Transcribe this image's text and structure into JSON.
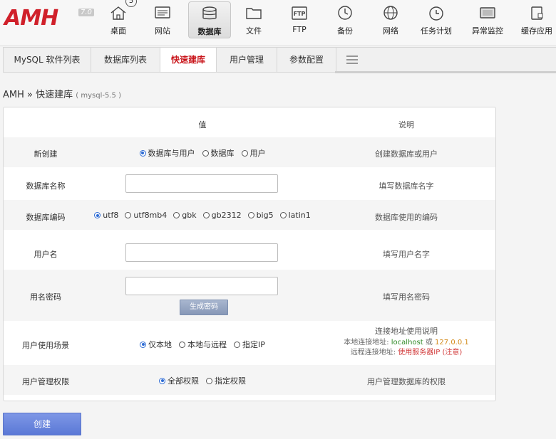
{
  "logo": {
    "text": "AMH",
    "version": "7.0"
  },
  "nav": {
    "badge": "5",
    "items": [
      {
        "label": "桌面",
        "icon": "home-icon"
      },
      {
        "label": "网站",
        "icon": "website-icon"
      },
      {
        "label": "数据库",
        "icon": "database-icon"
      },
      {
        "label": "文件",
        "icon": "folder-icon"
      },
      {
        "label": "FTP",
        "icon": "ftp-icon"
      },
      {
        "label": "备份",
        "icon": "clock-icon"
      },
      {
        "label": "网络",
        "icon": "globe-icon"
      },
      {
        "label": "任务计划",
        "icon": "timer-icon"
      },
      {
        "label": "异常监控",
        "icon": "monitor-icon"
      },
      {
        "label": "缓存应用",
        "icon": "cache-icon"
      }
    ],
    "active": "数据库"
  },
  "subtabs": [
    {
      "label": "MySQL 软件列表"
    },
    {
      "label": "数据库列表"
    },
    {
      "label": "快速建库"
    },
    {
      "label": "用户管理"
    },
    {
      "label": "参数配置"
    }
  ],
  "breadcrumb": {
    "root": "AMH",
    "sep": "»",
    "current": "快速建库",
    "version": "( mysql-5.5 )"
  },
  "table": {
    "header_value": "值",
    "header_desc": "说明",
    "rows": {
      "create": {
        "label": "新创建",
        "options": [
          "数据库与用户",
          "数据库",
          "用户"
        ],
        "desc": "创建数据库或用户"
      },
      "db_name": {
        "label": "数据库名称",
        "value": "",
        "desc": "填写数据库名字"
      },
      "db_charset": {
        "label": "数据库编码",
        "options": [
          "utf8",
          "utf8mb4",
          "gbk",
          "gb2312",
          "big5",
          "latin1"
        ],
        "desc": "数据库使用的编码"
      },
      "username": {
        "label": "用户名",
        "value": "",
        "desc": "填写用户名字"
      },
      "password": {
        "label": "用名密码",
        "value": "",
        "gen_label": "生成密码",
        "desc": "填写用名密码"
      },
      "scene": {
        "label": "用户使用场景",
        "options": [
          "仅本地",
          "本地与远程",
          "指定IP"
        ],
        "desc_title": "连接地址使用说明",
        "local_label": "本地连接地址:",
        "local_host": "localhost",
        "local_or": "或",
        "local_ip": "127.0.0.1",
        "remote_label": "远程连接地址:",
        "remote_value": "使用服务器IP (注意)"
      },
      "perm": {
        "label": "用户管理权限",
        "options": [
          "全部权限",
          "指定权限"
        ],
        "desc": "用户管理数据库的权限"
      }
    }
  },
  "create_button": "创建",
  "colors": {
    "brand": "#d0202a",
    "accent": "#2d6bd4",
    "active_tab": "#c9161c"
  }
}
